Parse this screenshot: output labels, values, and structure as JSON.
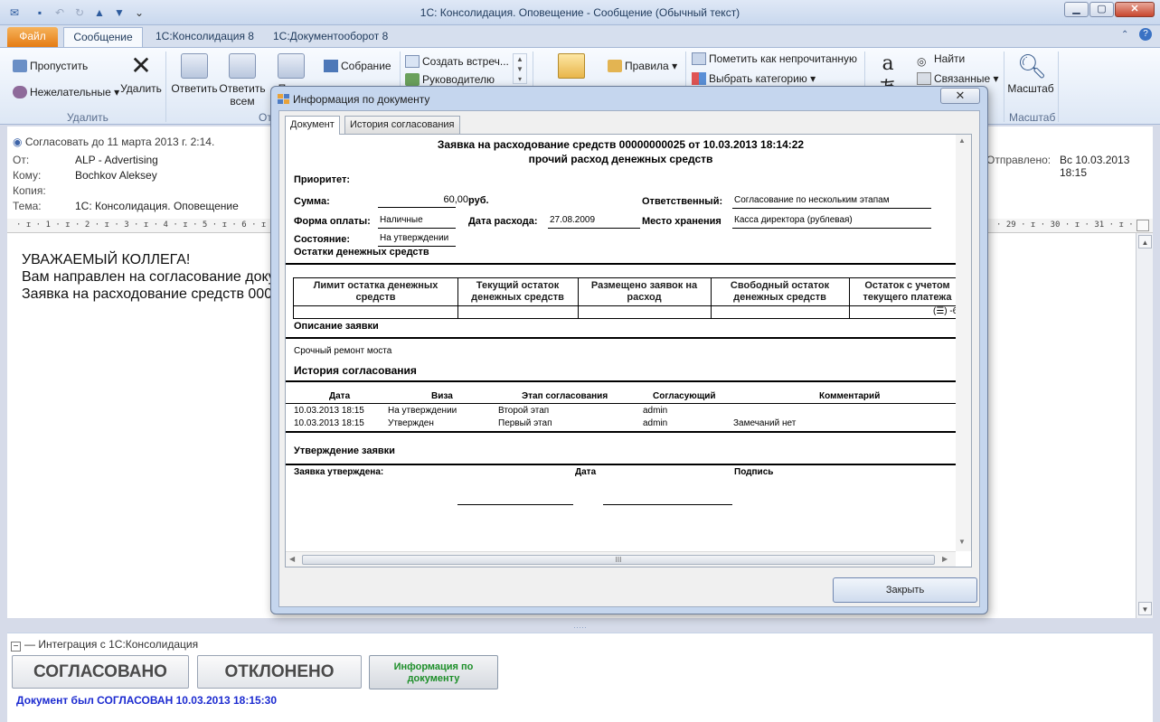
{
  "window": {
    "title": "1С: Консолидация. Оповещение - Сообщение (Обычный текст)",
    "min": "▁",
    "max": "▢",
    "close": "✕"
  },
  "tabs": {
    "file": "Файл",
    "message": "Сообщение",
    "kons": "1С:Консолидация 8",
    "doc": "1С:Документооборот 8"
  },
  "ribbon": {
    "skip": "Пропустить",
    "junk": "Нежелательные",
    "delete": "Удалить",
    "reply": "Ответить",
    "reply_all": "Ответить всем",
    "forward_partial": "Пере",
    "meeting": "Собрание",
    "create_meeting": "Создать встреч...",
    "to_manager": "Руководителю",
    "rules": "Правила",
    "mark_unread": "Пометить как непрочитанную",
    "categorize": "Выбрать категорию",
    "find": "Найти",
    "related": "Связанные",
    "zoom": "Масштаб",
    "group_delete": "Удалить",
    "group_respond_partial": "От",
    "group_zoom": "Масштаб"
  },
  "message": {
    "infobar": "Согласовать до 11 марта 2013 г. 2:14.",
    "from_label": "От:",
    "from": "ALP - Advertising",
    "to_label": "Кому:",
    "to": "Bochkov Aleksey",
    "cc_label": "Копия:",
    "cc": "",
    "subject_label": "Тема:",
    "subject": "1С: Консолидация. Оповещение",
    "sent_label": "Отправлено:",
    "sent": "Вс 10.03.2013 18:15",
    "ruler": "· ɪ · 1 · ɪ · 2 · ɪ · 3 · ɪ · 4 · ɪ · 5 · ɪ · 6 · ɪ · 7 · ɪ · 8 ·",
    "ruler_right": "· 29 · ɪ · 30 · ɪ · 31 · ɪ · 32 ·",
    "body": [
      "УВАЖАЕМЫЙ КОЛЛЕГА!",
      "Вам направлен на согласование докум",
      "Заявка на расходование средств 000000"
    ]
  },
  "integration": {
    "title": "Интеграция с 1С:Консолидация",
    "approve": "СОГЛАСОВАНО",
    "reject": "ОТКЛОНЕНО",
    "info": "Информация по документу",
    "status": "Документ был СОГЛАСОВАН 10.03.2013 18:15:30"
  },
  "dialog": {
    "title": "Информация по документу",
    "tab_doc": "Документ",
    "tab_hist": "История согласования",
    "close_button": "Закрыть",
    "hscroll_grip": "III",
    "doc": {
      "title1": "Заявка на расходование средств 00000000025 от 10.03.2013 18:14:22",
      "title2": "прочий расход денежных средств",
      "priority_label": "Приоритет:",
      "sum_label": "Сумма:",
      "sum_value": "60,00",
      "sum_currency": "руб.",
      "responsible_label": "Ответственный:",
      "responsible_value": "Согласование по нескольким этапам",
      "payform_label": "Форма оплаты:",
      "payform_value": "Наличные",
      "date_label": "Дата расхода:",
      "date_value": "27.08.2009",
      "storage_label": "Место хранения",
      "storage_value": "Касса директора (рублевая)",
      "state_label": "Состояние:",
      "state_value": "На утверждении",
      "balances_header": "Остатки денежных средств",
      "balances_cols": [
        "Лимит остатка денежных средств",
        "Текущий остаток денежных средств",
        "Размещено заявок на расход",
        "Свободный остаток денежных средств",
        "Остаток с учетом текущего платежа"
      ],
      "balances_tail": "(☰) -6",
      "desc_header": "Описание заявки",
      "desc_text": "Срочный ремонт моста",
      "history_header": "История согласования",
      "history_cols": [
        "Дата",
        "Виза",
        "Этап согласования",
        "Согласующий",
        "Комментарий"
      ],
      "history_rows": [
        [
          "10.03.2013 18:15",
          "На утверждении",
          "Второй этап",
          "admin",
          ""
        ],
        [
          "10.03.2013 18:15",
          "Утвержден",
          "Первый этап",
          "admin",
          "Замечаний нет"
        ]
      ],
      "approval_header": "Утверждение заявки",
      "approved_label": "Заявка утверждена:",
      "approval_date_label": "Дата",
      "signature_label": "Подпись"
    }
  },
  "colors": {
    "accent": "#e57b13",
    "status_blue": "#1b2ad0",
    "info_green": "#1e8f2a",
    "ribbon_bg": "#dde7f5"
  }
}
